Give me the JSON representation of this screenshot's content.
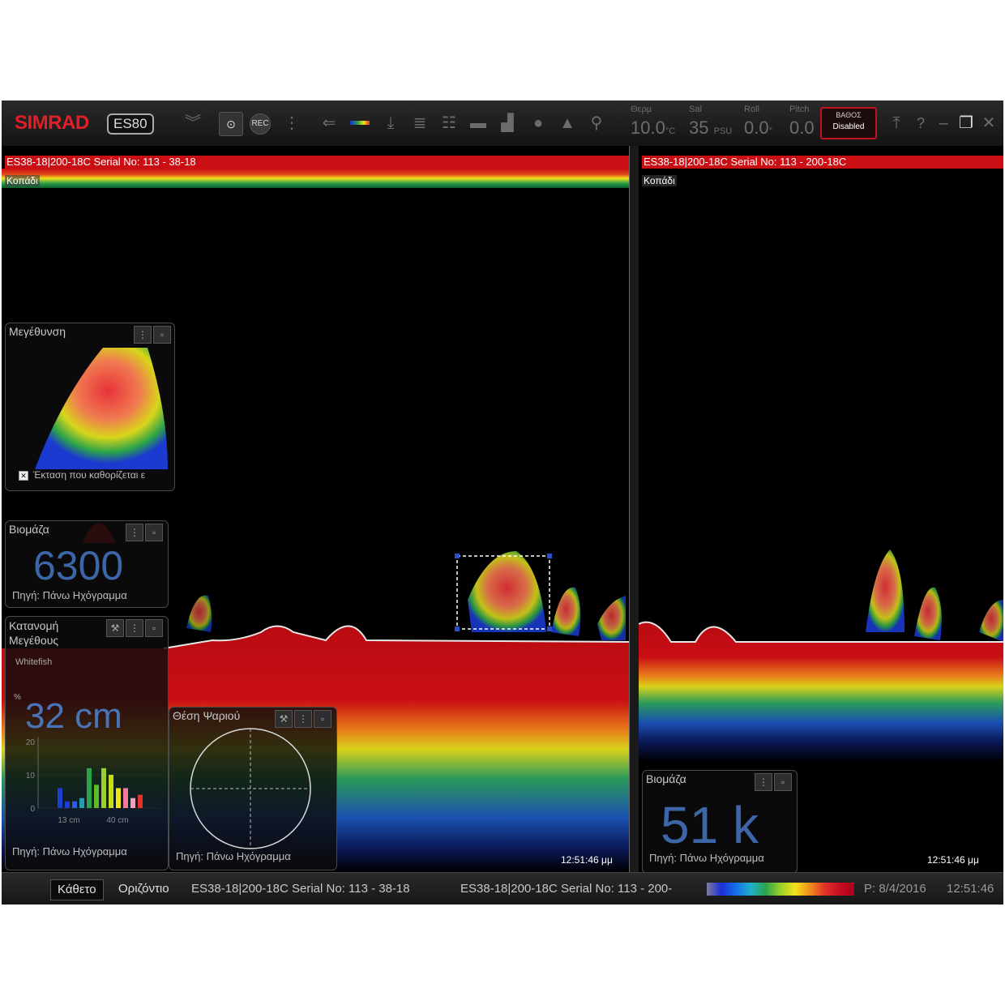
{
  "toolbar": {
    "brand": "SIMRAD",
    "model": "ES80",
    "rec_label": "REC",
    "sensors": [
      {
        "label": "Θερμ",
        "value": "10.0",
        "unit": "°C"
      },
      {
        "label": "Sal",
        "value": "35",
        "unit": "PSU"
      },
      {
        "label": "Roll",
        "value": "0.0",
        "unit": "°"
      },
      {
        "label": "Pitch",
        "value": "0.0",
        "unit": ""
      }
    ],
    "alarm": {
      "title": "ΒΑΘΟΣ",
      "status": "Disabled"
    },
    "help_label": "?"
  },
  "left_echogram": {
    "band_title": "ES38-18|200-18C Serial No: 113 - 38-18",
    "track_label": "Κοπάδι",
    "timestamp": "12:51:46 μμ"
  },
  "right_echogram": {
    "band_title": "ES38-18|200-18C Serial No: 113 - 200-18C",
    "track_label": "Κοπάδι",
    "timestamp": "12:51:46 μμ"
  },
  "zoom_widget": {
    "title": "Μεγέθυνση",
    "footer": "Έκταση που καθορίζεται ε"
  },
  "biomass_widget_left": {
    "title": "Βιομάζα",
    "value": "6300",
    "source": "Πηγή: Πάνω Ηχόγραμμα"
  },
  "size_widget": {
    "title_line1": "Κατανομή",
    "title_line2": "Μεγέθους",
    "species": "Whitefish",
    "percent_label": "%",
    "value": "32 cm",
    "y_ticks": [
      "20",
      "10",
      "0"
    ],
    "x_ticks": [
      "13 cm",
      "40 cm"
    ],
    "source": "Πηγή: Πάνω Ηχόγραμμα",
    "chart_data": {
      "type": "bar",
      "values": [
        6,
        2,
        2,
        3,
        12,
        7,
        12,
        10,
        6,
        6,
        3,
        4
      ],
      "colors": [
        "#1d3fd0",
        "#1d3fd0",
        "#2a60e0",
        "#20a0b0",
        "#2ba34a",
        "#5dbb2a",
        "#9ad12a",
        "#c8dc1a",
        "#f2e21a",
        "#f07a9a",
        "#f0a0b8",
        "#e2322b"
      ],
      "ylim": [
        0,
        20
      ]
    }
  },
  "fish_position_widget": {
    "title": "Θέση Ψαριού",
    "source": "Πηγή: Πάνω Ηχόγραμμα"
  },
  "biomass_widget_right": {
    "title": "Βιομάζα",
    "value": "51 k",
    "source": "Πηγή: Πάνω Ηχόγραμμα"
  },
  "statusbar": {
    "tab_vertical": "Κάθετο",
    "tab_horizontal": "Οριζόντιο",
    "channel1": "ES38-18|200-18C Serial No: 113 - 38-18",
    "channel2": "ES38-18|200-18C Serial No: 113 - 200-",
    "playback": "P: 8/4/2016",
    "time": "12:51:46"
  }
}
